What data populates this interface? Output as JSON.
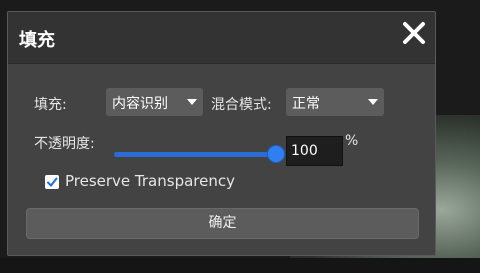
{
  "dialog": {
    "title": "填充",
    "fill_label": "填充:",
    "fill_value": "内容识别",
    "blend_label": "混合模式:",
    "blend_value": "正常",
    "opacity_label": "不透明度:",
    "opacity_value": "100",
    "opacity_unit": "%",
    "opacity_level": 1.0,
    "preserve_transparency_label": "Preserve Transparency",
    "preserve_transparency_checked": true,
    "ok_label": "确定"
  },
  "colors": {
    "accent": "#2f7ff0",
    "dialog_bg": "#434343",
    "titlebar_bg": "#333333"
  },
  "icons": {
    "close": "close-icon",
    "dropdown": "chevron-down-icon",
    "check": "checkmark-icon"
  }
}
